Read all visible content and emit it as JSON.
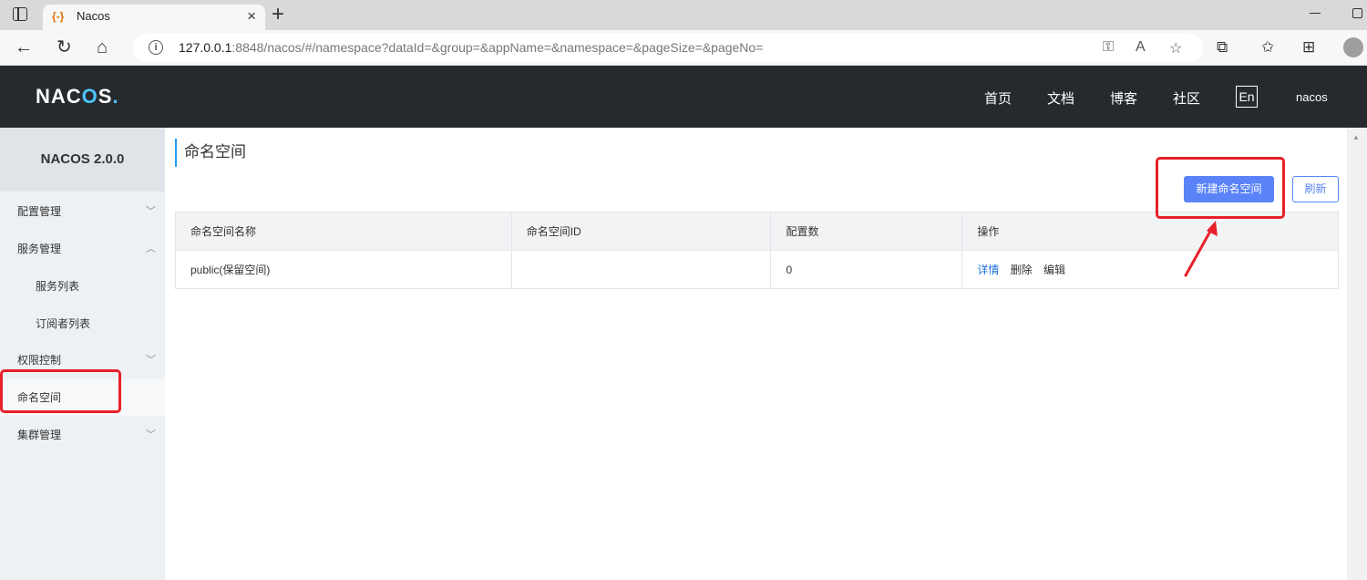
{
  "browser": {
    "tab_title": "Nacos",
    "favicon": "{-}",
    "url_host": "127.0.0.1",
    "url_rest": ":8848/nacos/#/namespace?dataId=&group=&appName=&namespace=&pageSize=&pageNo=",
    "icons": [
      "sidebar-toggle-icon",
      "close-icon",
      "plus-icon",
      "back-icon",
      "refresh-icon",
      "home-icon",
      "info-icon",
      "key-icon",
      "read-aloud-icon",
      "favorite-add-icon",
      "extensions-icon",
      "favorites-icon",
      "collections-icon",
      "profile-icon"
    ]
  },
  "header": {
    "logo": {
      "prefix": "NAC",
      "o": "O",
      "suffix": "S",
      "dot": "."
    },
    "nav": [
      "首页",
      "文档",
      "博客",
      "社区"
    ],
    "lang": "En",
    "user": "nacos"
  },
  "sidebar": {
    "version": "NACOS 2.0.0",
    "items": [
      {
        "label": "配置管理",
        "chevron": "﹀"
      },
      {
        "label": "服务管理",
        "chevron": "︿"
      },
      {
        "label": "服务列表"
      },
      {
        "label": "订阅者列表"
      },
      {
        "label": "权限控制",
        "chevron": "﹀"
      },
      {
        "label": "命名空间"
      },
      {
        "label": "集群管理",
        "chevron": "﹀"
      }
    ]
  },
  "main": {
    "title": "命名空间",
    "create_button": "新建命名空间",
    "refresh_button": "刷新",
    "table": {
      "headers": [
        "命名空间名称",
        "命名空间ID",
        "配置数",
        "操作"
      ],
      "rows": [
        {
          "name": "public(保留空间)",
          "id": "",
          "count": "0",
          "actions": [
            "详情",
            "删除",
            "编辑"
          ]
        }
      ]
    }
  },
  "colors": {
    "header_bg": "#252a2f",
    "sidebar_bg": "#eef1f4",
    "primary": "#5983f7",
    "link": "#1e6fd9",
    "annotation": "#e8202a"
  }
}
